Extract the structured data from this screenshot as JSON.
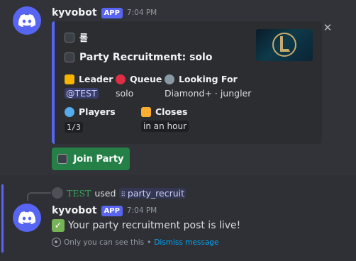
{
  "message1": {
    "username": "kyvobot",
    "badge": "APP",
    "time": "7:04 PM",
    "embed": {
      "author": "롤",
      "title": "Party Recruitment: solo",
      "fields": [
        {
          "name": "Leader",
          "value": "@TEST",
          "icon": "crown-icon",
          "icon_color": "#f4b400"
        },
        {
          "name": "Queue",
          "value": "solo",
          "icon": "target-icon",
          "icon_color": "#dd2e44"
        },
        {
          "name": "Looking For",
          "value": "Diamond+ · jungler",
          "icon": "magnifier-icon",
          "icon_color": "#8899a6"
        },
        {
          "name": "Players",
          "value": "1/3",
          "icon": "person-icon",
          "icon_color": "#55acee"
        },
        {
          "name": "Closes",
          "value": "in an hour",
          "icon": "hourglass-icon",
          "icon_color": "#ffac33"
        }
      ],
      "accent": "#5865f2"
    },
    "button": {
      "label": "Join Party",
      "color": "#248046"
    }
  },
  "interaction": {
    "user": "TEST",
    "used": "used",
    "command": "party_recruit"
  },
  "message2": {
    "username": "kyvobot",
    "badge": "APP",
    "time": "7:04 PM",
    "text": "Your party recruitment post is live!",
    "ephemeral_note": "Only you can see this",
    "separator": "•",
    "dismiss": "Dismiss message"
  }
}
